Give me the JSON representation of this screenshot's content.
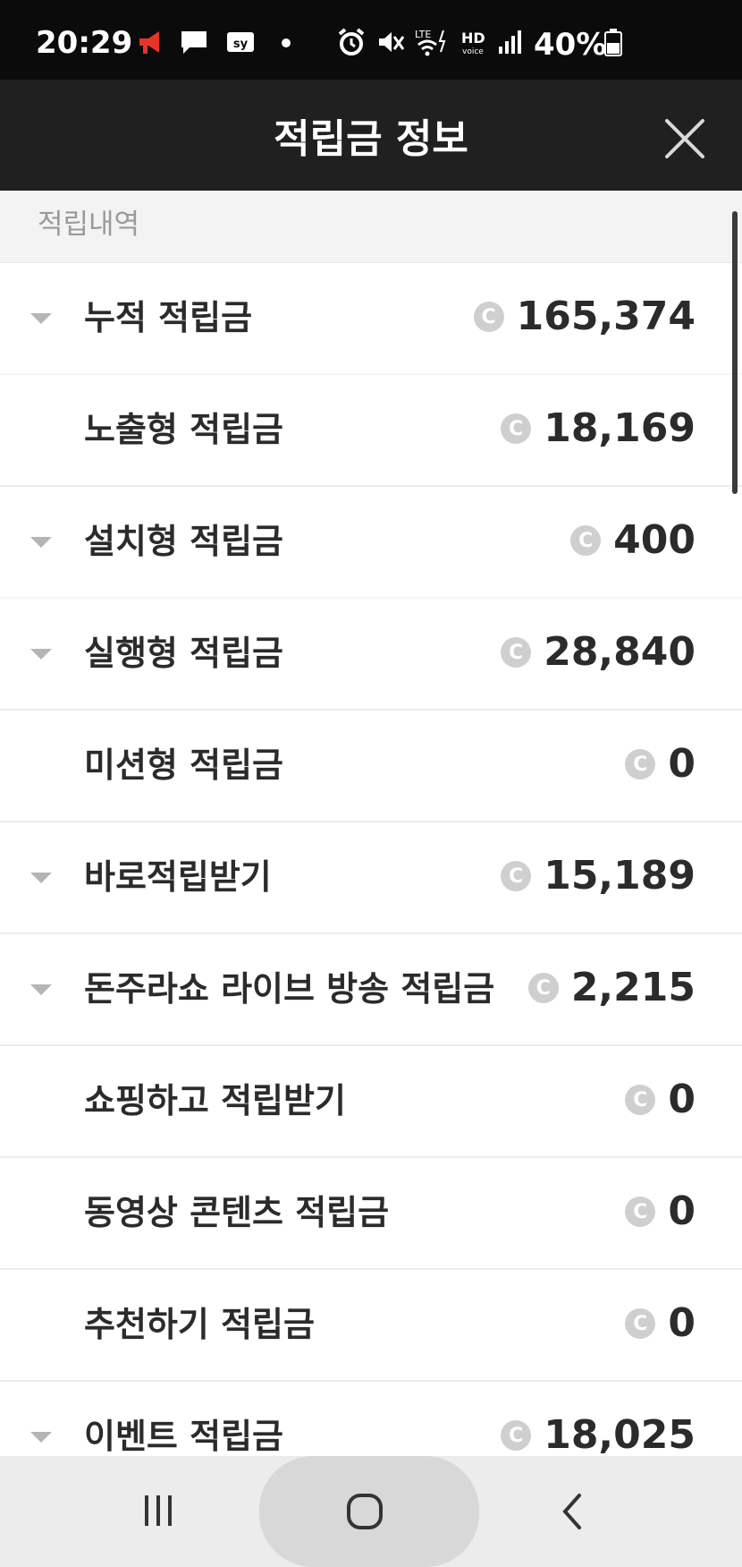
{
  "status_bar": {
    "time": "20:29",
    "battery": "40%",
    "icons": [
      "megaphone-icon",
      "chat-icon",
      "sy-app-icon",
      "dot-icon",
      "alarm-icon",
      "mute-icon",
      "lte-wifi-icon",
      "hd-voice-icon",
      "signal-icon",
      "battery-icon"
    ]
  },
  "header": {
    "title": "적립금 정보",
    "close_icon": "close-icon"
  },
  "section": {
    "label": "적립내역"
  },
  "rows": [
    {
      "label": "누적 적립금",
      "amount": "165,374",
      "expandable": true
    },
    {
      "label": "노출형 적립금",
      "amount": "18,169",
      "expandable": false
    },
    {
      "label": "설치형 적립금",
      "amount": "400",
      "expandable": true
    },
    {
      "label": "실행형 적립금",
      "amount": "28,840",
      "expandable": true
    },
    {
      "label": "미션형 적립금",
      "amount": "0",
      "expandable": false
    },
    {
      "label": "바로적립받기",
      "amount": "15,189",
      "expandable": true
    },
    {
      "label": "돈주라쇼 라이브 방송 적립금",
      "amount": "2,215",
      "expandable": true
    },
    {
      "label": "쇼핑하고 적립받기",
      "amount": "0",
      "expandable": false
    },
    {
      "label": "동영상 콘텐츠 적립금",
      "amount": "0",
      "expandable": false
    },
    {
      "label": "추천하기 적립금",
      "amount": "0",
      "expandable": false
    },
    {
      "label": "이벤트 적립금",
      "amount": "18,025",
      "expandable": true
    }
  ],
  "coin_symbol": "C",
  "nav_bar": {
    "buttons": [
      "recent-apps-icon",
      "home-icon",
      "back-icon"
    ]
  },
  "colors": {
    "status_bg": "#0b0b0b",
    "header_bg": "#202020",
    "section_bg": "#f3f3f3",
    "text": "#2b2b2b",
    "coin": "#cfcfcf",
    "chevron": "#b5b5b5"
  }
}
